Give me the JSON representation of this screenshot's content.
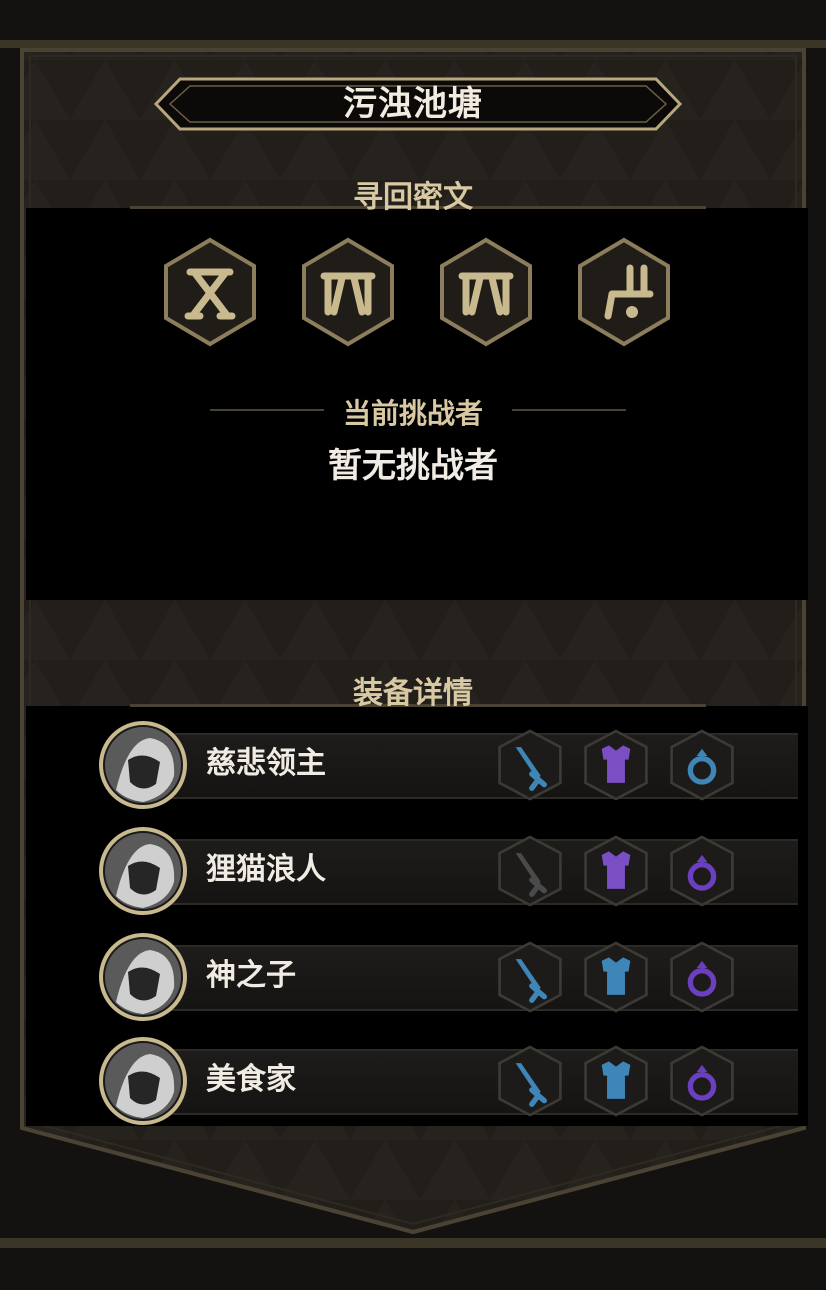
{
  "stage": {
    "title": "污浊池塘"
  },
  "runes": {
    "label": "寻回密文",
    "items": [
      {
        "icon": "rune-x-icon"
      },
      {
        "icon": "rune-arch-icon"
      },
      {
        "icon": "rune-arch-icon"
      },
      {
        "icon": "rune-hook-icon"
      }
    ]
  },
  "challenger": {
    "label": "当前挑战者",
    "value": "暂无挑战者"
  },
  "equipment": {
    "label": "装备详情",
    "heroes": [
      {
        "name": "慈悲领主",
        "avatar": "merciful-lord-portrait",
        "weapon_color": "#3f86b8",
        "armor_color": "#7a4fc4",
        "ring_color": "#3f86b8"
      },
      {
        "name": "狸猫浪人",
        "avatar": "raccoon-ronin-portrait",
        "weapon_color": "#4a4a4a",
        "armor_color": "#7a4fc4",
        "ring_color": "#6a3fc0"
      },
      {
        "name": "神之子",
        "avatar": "child-of-god-portrait",
        "weapon_color": "#3f86b8",
        "armor_color": "#3f86b8",
        "ring_color": "#6a3fc0"
      },
      {
        "name": "美食家",
        "avatar": "gourmet-portrait",
        "weapon_color": "#3f86b8",
        "armor_color": "#3f86b8",
        "ring_color": "#6a3fc0"
      }
    ]
  },
  "colors": {
    "gold": "#b8a77c",
    "panel": "#000000",
    "accent_text": "#d9c9a3"
  }
}
